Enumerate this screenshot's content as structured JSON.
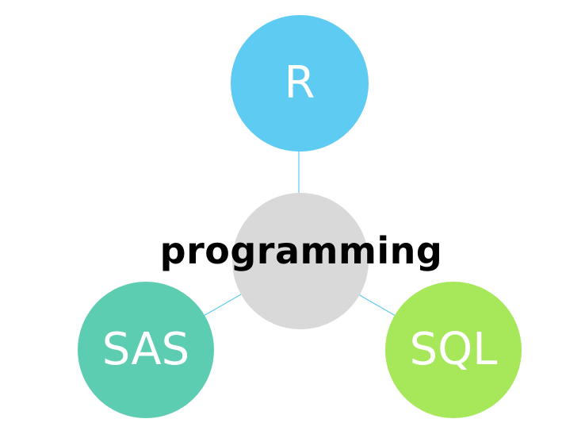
{
  "diagram": {
    "center": {
      "label": "programming",
      "fill": "#d9d9d9"
    },
    "nodes": [
      {
        "id": "r",
        "label": "R",
        "fill": "#5ecbf3"
      },
      {
        "id": "sas",
        "label": "SAS",
        "fill": "#5ccdb0"
      },
      {
        "id": "sql",
        "label": "SQL",
        "fill": "#a6e85a"
      }
    ],
    "connector_color": "#5ecbf3"
  }
}
